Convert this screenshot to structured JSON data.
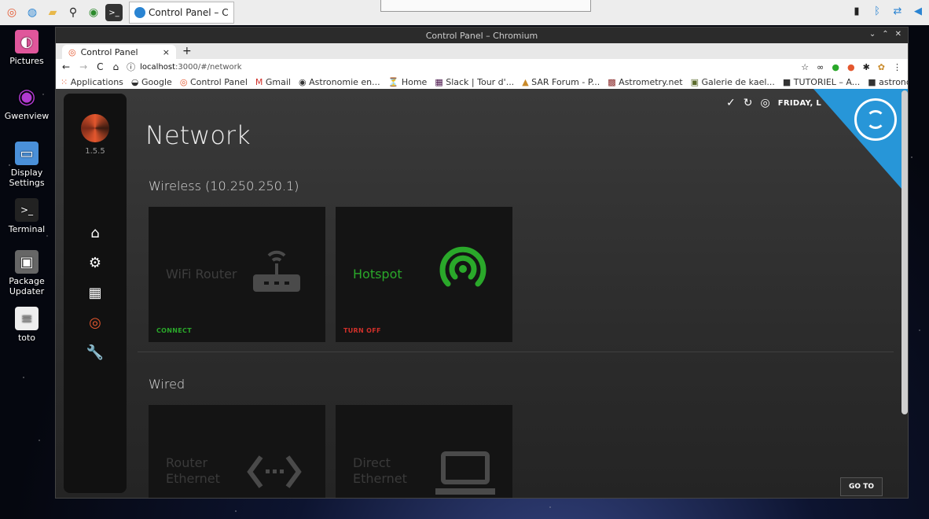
{
  "taskbar": {
    "task_label": "Control Panel – Chro..."
  },
  "desktop": {
    "items": [
      {
        "label": "Pictures"
      },
      {
        "label": "Gwenview"
      },
      {
        "label": "Display Settings"
      },
      {
        "label": "Terminal"
      },
      {
        "label": "Package Updater"
      },
      {
        "label": "toto"
      }
    ]
  },
  "window": {
    "title": "Control Panel – Chromium",
    "tab_title": "Control Panel",
    "url_prefix": "localhost",
    "url_rest": ":3000/#/network",
    "bookmarks": [
      "Applications",
      "Google",
      "Control Panel",
      "Gmail",
      "Astronomie en...",
      "Home",
      "Slack | Tour d'...",
      "SAR Forum - P...",
      "Astrometry.net",
      "Galerie de kael...",
      "TUTORIEL – A...",
      "astronomy.too..."
    ]
  },
  "app": {
    "version": "1.5.5",
    "page_title": "Network",
    "status_date": "FRIDAY, L",
    "wireless_heading": "Wireless (10.250.250.1)",
    "wired_heading": "Wired",
    "cards": {
      "wifi_router": {
        "label": "WiFi Router",
        "action": "CONNECT"
      },
      "hotspot": {
        "label": "Hotspot",
        "action": "TURN OFF"
      },
      "router_ethernet": {
        "label_line1": "Router",
        "label_line2": "Ethernet"
      },
      "direct_ethernet": {
        "label_line1": "Direct",
        "label_line2": "Ethernet"
      }
    },
    "goto_label": "GO TO",
    "colors": {
      "accent": "#e4572e",
      "active_green": "#2aa82a",
      "danger_red": "#d0302a",
      "corner_blue": "#2796d8"
    }
  }
}
